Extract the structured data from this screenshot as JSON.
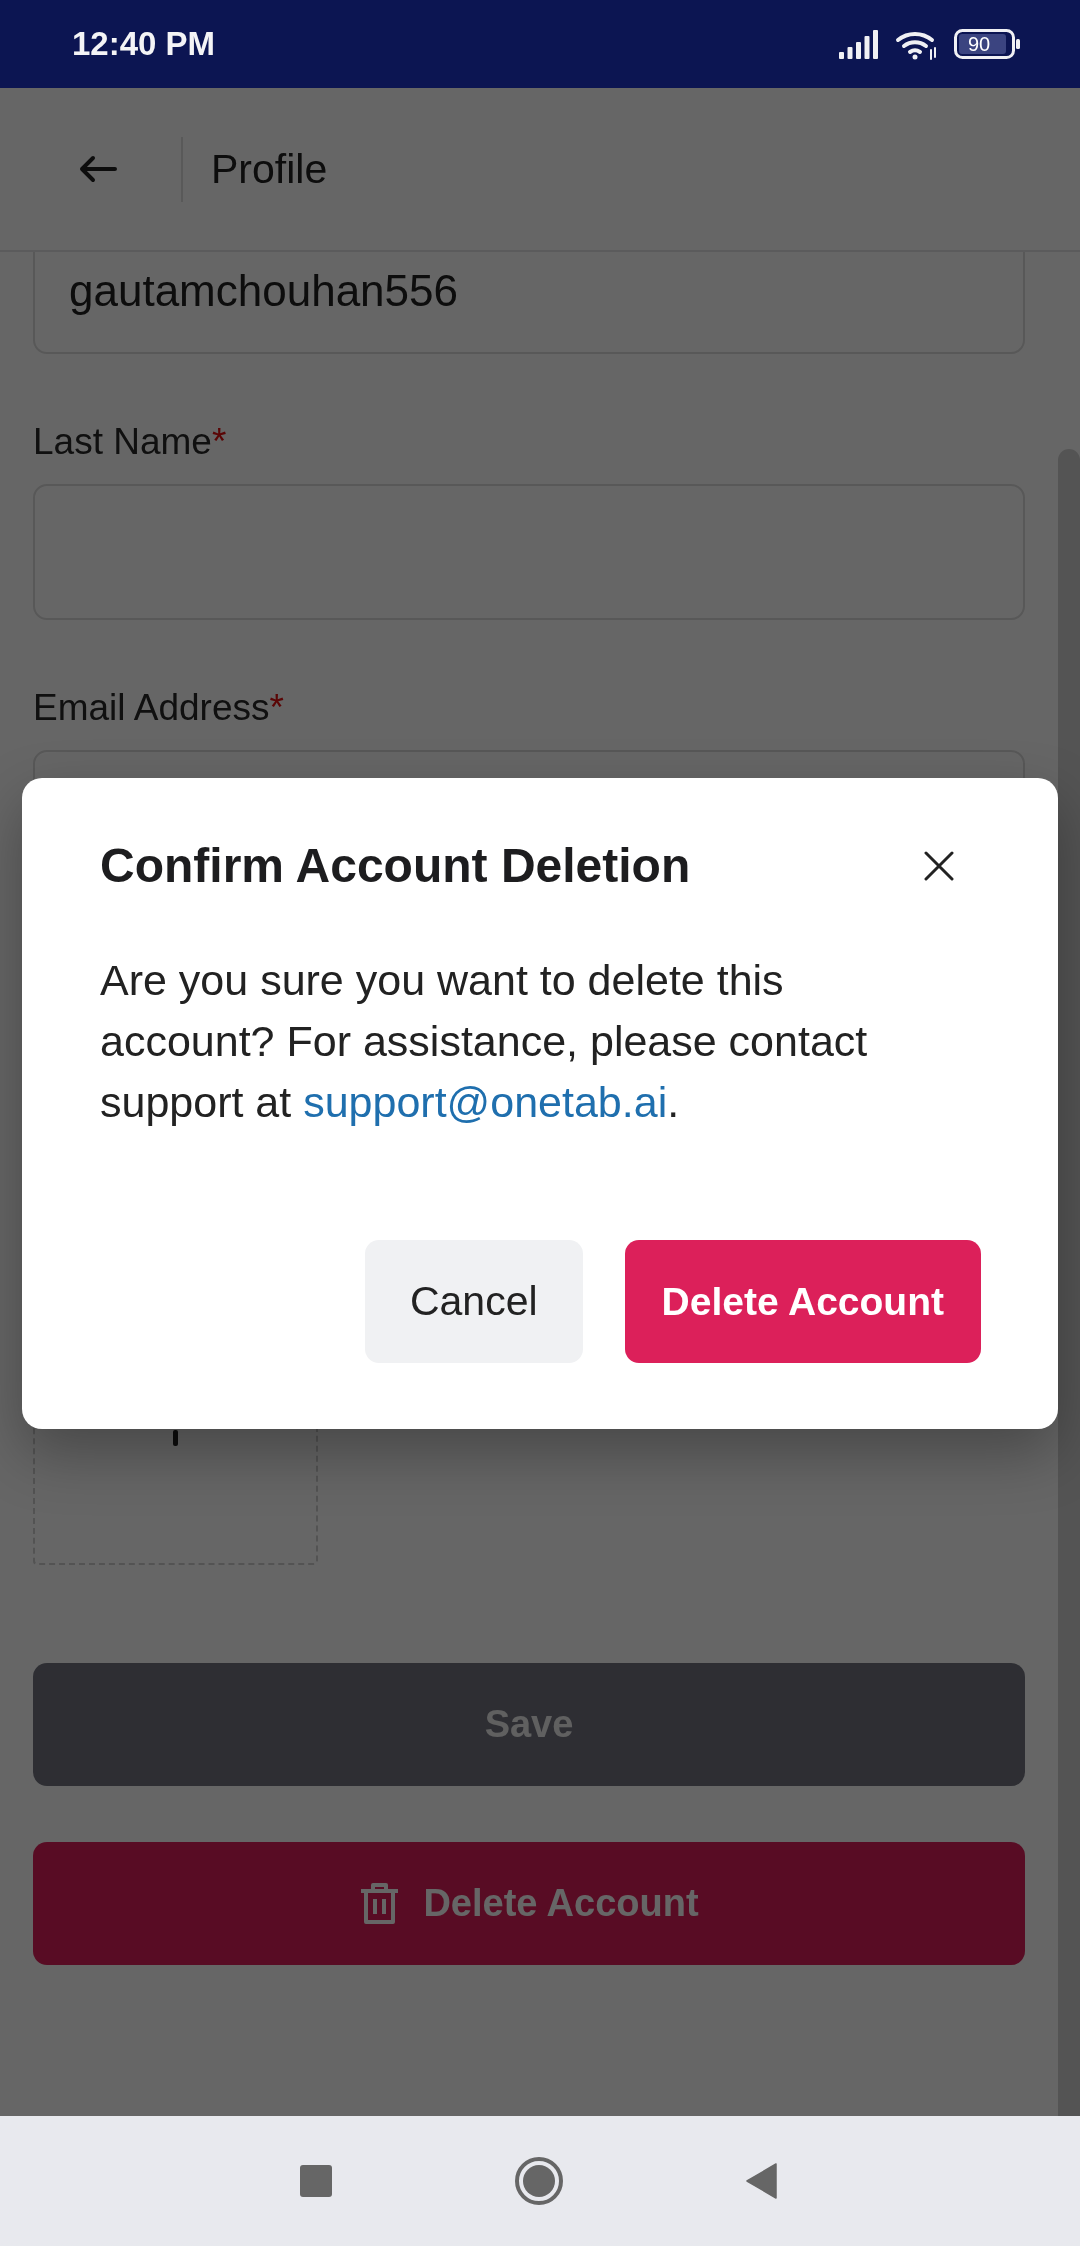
{
  "status_bar": {
    "time": "12:40 PM",
    "battery": "90"
  },
  "header": {
    "title": "Profile"
  },
  "form": {
    "fields": [
      {
        "kind": "partial",
        "value": "gautamchouhan556"
      },
      {
        "kind": "text",
        "label": "Last Name",
        "required_mark": "*"
      },
      {
        "kind": "text",
        "label": "Email Address",
        "required_mark": "*"
      }
    ]
  },
  "actions": [
    {
      "kind": "primary",
      "label": "Save",
      "disabled": true
    },
    {
      "kind": "danger",
      "label": "Delete Account",
      "disabled": false
    }
  ],
  "dialog": {
    "title": "Confirm Account Deletion",
    "message": "Are you sure you want to delete this account? For assistance, please contact support at ",
    "link": "support@onetab.ai",
    "message_end": ".",
    "buttons": [
      {
        "kind": "secondary",
        "label": "Cancel"
      },
      {
        "kind": "danger",
        "label": "Delete Account"
      }
    ]
  }
}
